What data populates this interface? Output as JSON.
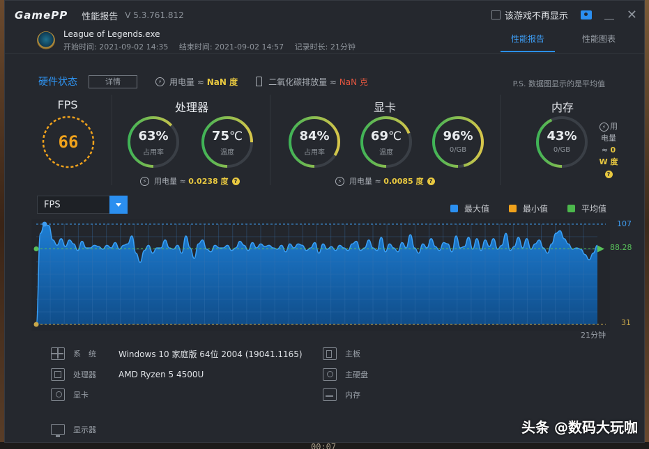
{
  "app": {
    "logo": "GamePP",
    "title": "性能报告",
    "version": "V 5.3.761.812",
    "hide_checkbox_label": "该游戏不再显示"
  },
  "game": {
    "name": "League of Legends.exe",
    "start": "开始时间: 2021-09-02 14:35",
    "end": "结束时间: 2021-09-02 14:57",
    "duration": "记录时长: 21分钟"
  },
  "tabs": [
    {
      "label": "性能报告",
      "active": true
    },
    {
      "label": "性能图表",
      "active": false
    }
  ],
  "hardware": {
    "title": "硬件状态",
    "detail_button": "详情",
    "power_label": "用电量 ≈",
    "power_value": "NaN 度",
    "co2_label": "二氧化碳排放量 ≈",
    "co2_value": "NaN 克",
    "note": "P.S. 数据图显示的是平均值"
  },
  "panels": {
    "fps": {
      "title": "FPS",
      "value": "66"
    },
    "cpu": {
      "title": "处理器",
      "usage": {
        "value": "63%",
        "label": "占用率",
        "fraction": 0.63
      },
      "temp": {
        "value": "75",
        "unit": "℃",
        "label": "温度",
        "fraction": 0.75
      },
      "power_label": "用电量 ≈",
      "power_value": "0.0238 度"
    },
    "gpu": {
      "title": "显卡",
      "usage": {
        "value": "84%",
        "label": "占用率",
        "fraction": 0.84
      },
      "temp": {
        "value": "69",
        "unit": "℃",
        "label": "温度",
        "fraction": 0.69
      },
      "vram": {
        "value": "96%",
        "label": "0/GB",
        "fraction": 0.96
      },
      "power_label": "用电量 ≈",
      "power_value": "0.0085 度"
    },
    "memory": {
      "title": "内存",
      "usage": {
        "value": "43%",
        "label": "0/GB",
        "fraction": 0.43
      },
      "power_line1": "用",
      "power_line2": "电量",
      "power_line3": "≈",
      "power_value": "0",
      "power_unit": "W 度"
    }
  },
  "chart_controls": {
    "selected_metric": "FPS",
    "legend": [
      {
        "label": "最大值",
        "color": "#2b8ff0"
      },
      {
        "label": "最小值",
        "color": "#f0a21c"
      },
      {
        "label": "平均值",
        "color": "#4cb84c"
      }
    ]
  },
  "chart_data": {
    "type": "area",
    "title": "",
    "xlabel": "",
    "ylabel": "",
    "x_end_label": "21分钟",
    "ylim": [
      31,
      107
    ],
    "max_label": "107",
    "avg_label": "88.28",
    "min_label": "31",
    "max": 107,
    "avg": 88.28,
    "min": 31,
    "series": [
      {
        "values": [
          31,
          100,
          107,
          106,
          95,
          91,
          96,
          90,
          95,
          92,
          87,
          94,
          89,
          89,
          91,
          90,
          88,
          91,
          89,
          93,
          88,
          91,
          92,
          98,
          85,
          78,
          87,
          91,
          85,
          89,
          89,
          95,
          89,
          88,
          91,
          85,
          98,
          89,
          81,
          92,
          95,
          88,
          86,
          91,
          89,
          89,
          91,
          87,
          89,
          94,
          91,
          87,
          93,
          89,
          92,
          90,
          91,
          89,
          88,
          91,
          86,
          92,
          89,
          92,
          91,
          87,
          89,
          93,
          85,
          92,
          88,
          90,
          87,
          91,
          89,
          87,
          92,
          94,
          87,
          89,
          95,
          89,
          87,
          97,
          86,
          92,
          89,
          86,
          93,
          89,
          99,
          89,
          85,
          92,
          89,
          96,
          90,
          87,
          93,
          92,
          86,
          98,
          89,
          90,
          97,
          88,
          96,
          87,
          95,
          90,
          96,
          88,
          91,
          100,
          87,
          90,
          97,
          89,
          96,
          88,
          92,
          95,
          89,
          85,
          92,
          100,
          102,
          96,
          92,
          88,
          89,
          88,
          84,
          80,
          85,
          91
        ]
      }
    ]
  },
  "system": {
    "os": {
      "label": "系　统",
      "value": "Windows 10 家庭版 64位   2004 (19041.1165)"
    },
    "cpu": {
      "label": "处理器",
      "value": "AMD Ryzen 5 4500U"
    },
    "gpu": {
      "label": "显卡",
      "value": ""
    },
    "monitor": {
      "label": "显示器",
      "value": ""
    },
    "board": {
      "label": "主板",
      "value": ""
    },
    "disk": {
      "label": "主硬盘",
      "value": ""
    },
    "ram": {
      "label": "内存",
      "value": ""
    }
  },
  "watermark": "头条 @数码大玩咖",
  "background_time": "00:07"
}
